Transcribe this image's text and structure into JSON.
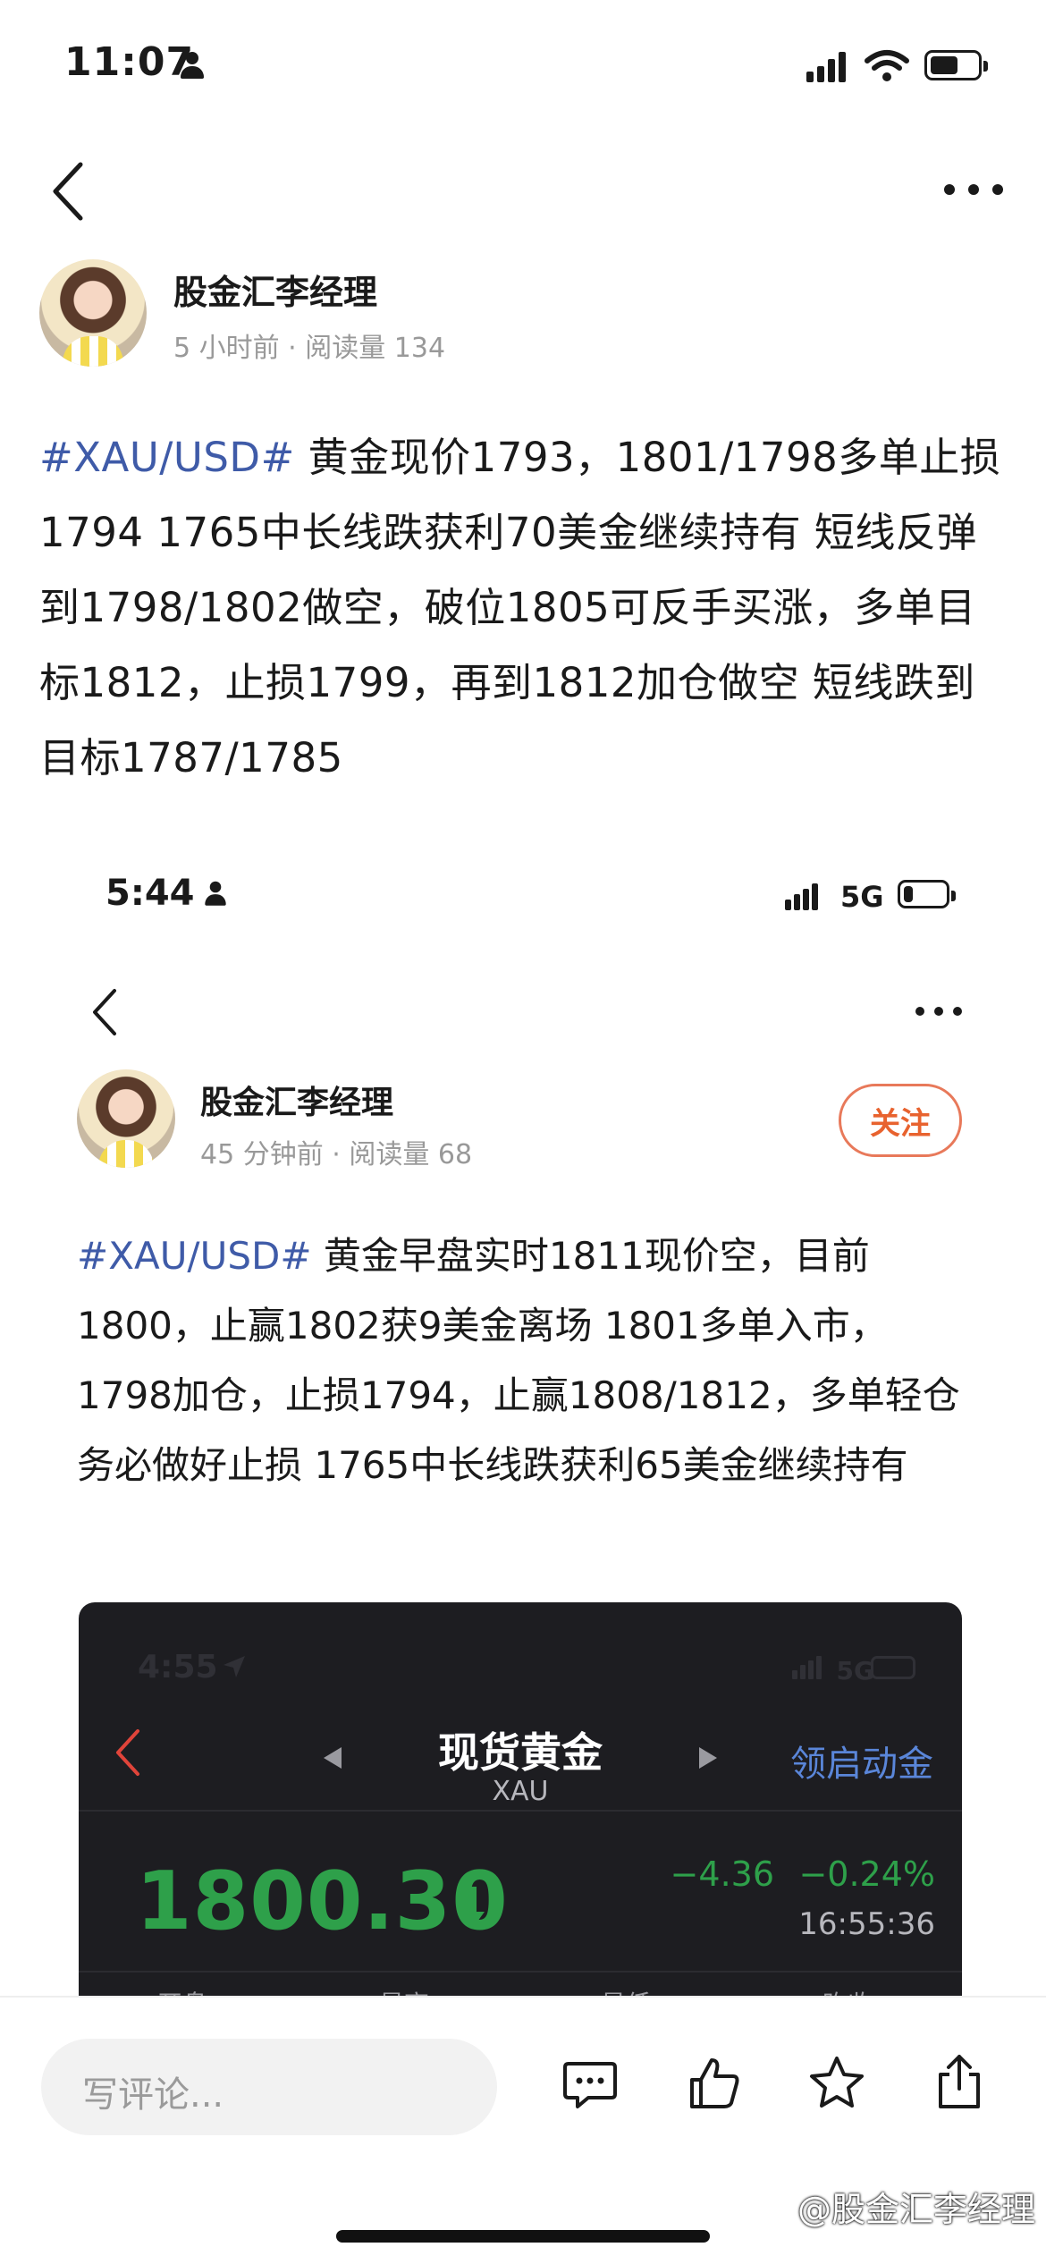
{
  "status_bar": {
    "time": "11:07"
  },
  "nav": {
    "more_label": "•••"
  },
  "post": {
    "author": "股金汇李经理",
    "meta": "5 小时前 · 阅读量 134",
    "hashtag": "#XAU/USD#",
    "body": " 黄金现价1793，1801/1798多单止损1794 1765中长线跌获利70美金继续持有 短线反弹到1798/1802做空，破位1805可反手买涨，多单目标1812，止损1799，再到1812加仓做空 短线跌到目标1787/1785"
  },
  "embedded": {
    "status_time": "5:44",
    "status_network": "5G",
    "author": "股金汇李经理",
    "meta": "45 分钟前 · 阅读量 68",
    "follow_label": "关注",
    "hashtag": "#XAU/USD#",
    "body": " 黄金早盘实时1811现价空，目前1800，止赢1802获9美金离场 1801多单入市，1798加仓，止损1794，止赢1808/1812，多单轻仓务必做好止损 1765中长线跌获利65美金继续持有"
  },
  "quote_screen": {
    "status_time": "4:55",
    "status_network": "5G",
    "title": "现货黄金",
    "symbol": "XAU",
    "link": "领启动金",
    "price": "1800.30",
    "change": "−4.36",
    "change_pct": "−0.24%",
    "time": "16:55:36",
    "columns": [
      "开盘",
      "最高",
      "最低",
      "昨收"
    ],
    "colors": {
      "down": "#2ea04a",
      "link": "#5a86d9",
      "back": "#e0443a"
    }
  },
  "bottom_bar": {
    "comment_placeholder": "写评论..."
  },
  "watermark": "@股金汇李经理"
}
